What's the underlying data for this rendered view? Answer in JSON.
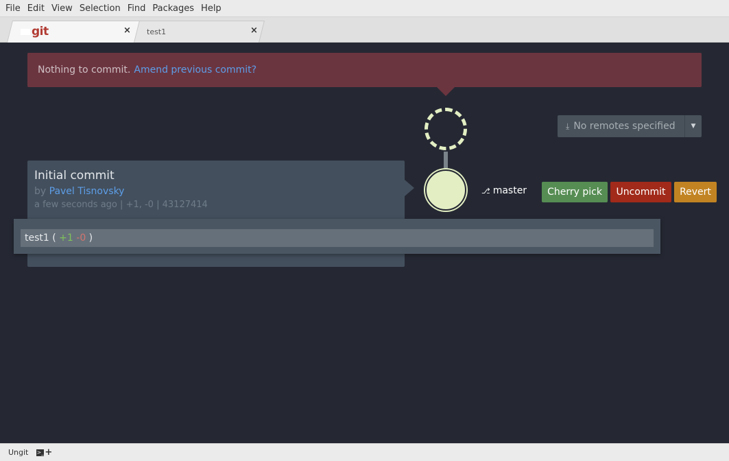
{
  "menu": [
    "File",
    "Edit",
    "View",
    "Selection",
    "Find",
    "Packages",
    "Help"
  ],
  "tabs": [
    {
      "logo": "git",
      "close": "×"
    },
    {
      "label": "test1",
      "close": "×"
    }
  ],
  "alert": {
    "text": "Nothing to commit.",
    "link": "Amend previous commit?"
  },
  "remotes": {
    "label": "No remotes specified",
    "icon": "download-icon"
  },
  "graph": {
    "branch": "master"
  },
  "actions": {
    "cherry_pick": "Cherry pick",
    "uncommit": "Uncommit",
    "revert": "Revert"
  },
  "commit": {
    "title": "Initial commit",
    "by": "by",
    "author": "Pavel Tisnovsky",
    "time": "a few seconds ago",
    "sep": "|",
    "diffstat": "+1, -0",
    "hash": "43127414"
  },
  "files": [
    {
      "name": "test1",
      "added": "+1",
      "removed": "-0"
    }
  ],
  "statusbar": {
    "label": "Ungit"
  },
  "colors": {
    "background": "#252833",
    "alert": "#6b3540",
    "link": "#5d9ee8",
    "cherry_pick": "#568d53",
    "uncommit": "#a12a1a",
    "revert": "#c28423",
    "node": "#e3efc3"
  }
}
